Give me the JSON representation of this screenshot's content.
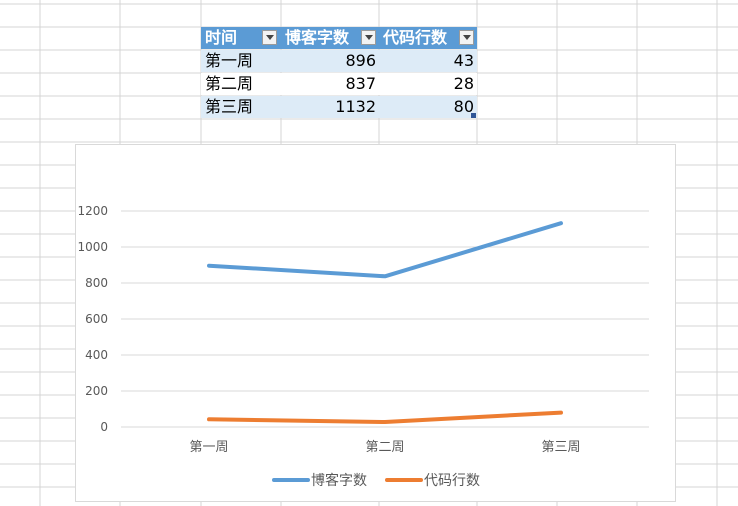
{
  "table": {
    "headers": [
      "时间",
      "博客字数",
      "代码行数"
    ],
    "rows": [
      [
        "第一周",
        "896",
        "43"
      ],
      [
        "第二周",
        "837",
        "28"
      ],
      [
        "第三周",
        "1132",
        "80"
      ]
    ]
  },
  "colors": {
    "header_bg": "#5b9bd5",
    "band_bg": "#ddebf7",
    "series_1": "#5b9bd5",
    "series_2": "#ed7d31",
    "gridline": "#d9d9d9"
  },
  "chart_data": {
    "type": "line",
    "categories": [
      "第一周",
      "第二周",
      "第三周"
    ],
    "series": [
      {
        "name": "博客字数",
        "values": [
          896,
          837,
          1132
        ]
      },
      {
        "name": "代码行数",
        "values": [
          43,
          28,
          80
        ]
      }
    ],
    "ylim": [
      0,
      1200
    ],
    "yticks": [
      0,
      200,
      400,
      600,
      800,
      1000,
      1200
    ],
    "grid": true,
    "legend": "bottom",
    "title": "",
    "xlabel": "",
    "ylabel": ""
  }
}
